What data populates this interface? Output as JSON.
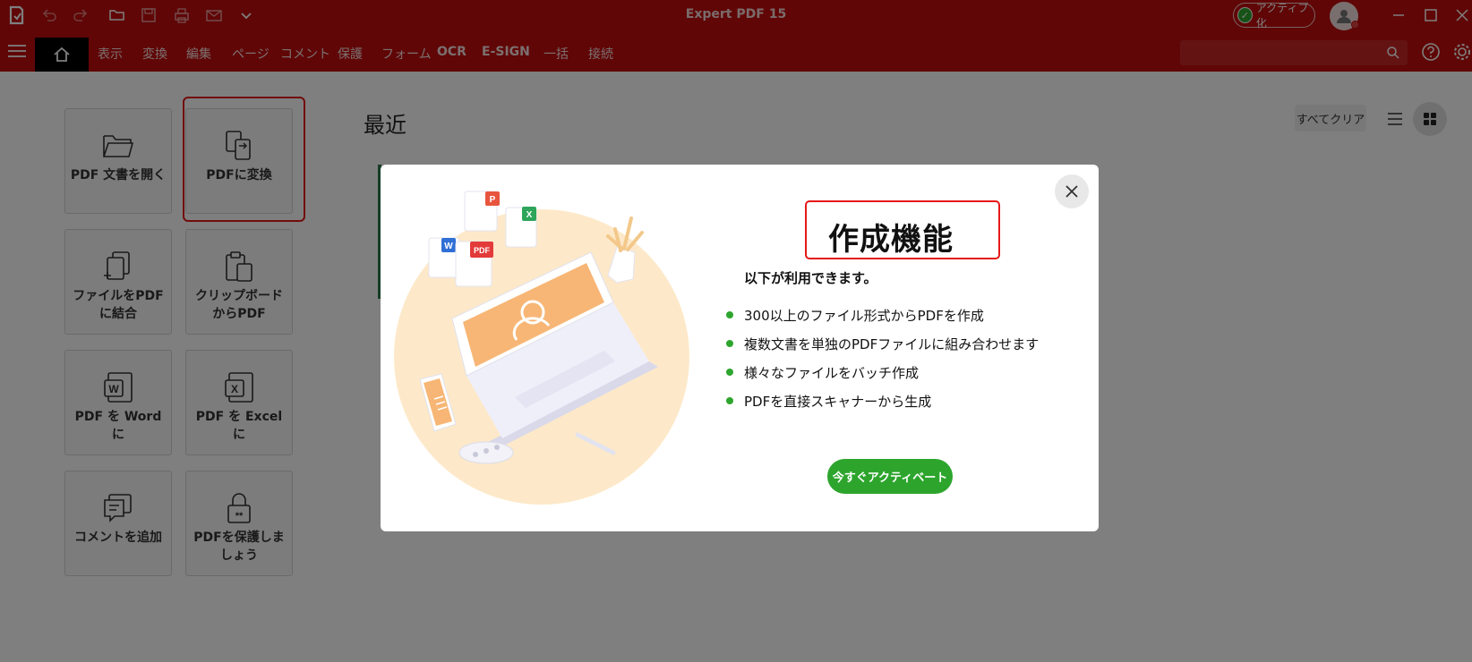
{
  "window": {
    "title": "Expert PDF 15",
    "activate_label": "アクティブ化",
    "brand_red": "#c10c0c"
  },
  "quick_access": [
    "undo-icon",
    "redo-icon",
    "open-folder-icon",
    "save-icon",
    "print-icon",
    "mail-icon",
    "chevron-down-icon"
  ],
  "menu": {
    "items": [
      {
        "label": "表示"
      },
      {
        "label": "変換"
      },
      {
        "label": "編集"
      },
      {
        "label": "ページ"
      },
      {
        "label": "コメント"
      },
      {
        "label": "保護"
      },
      {
        "label": "フォーム"
      },
      {
        "label": "OCR"
      },
      {
        "label": "E-SIGN"
      },
      {
        "label": "一括"
      },
      {
        "label": "接続"
      }
    ]
  },
  "tiles": [
    {
      "label": "PDF 文書を開く",
      "icon": "open-folder-icon"
    },
    {
      "label": "PDFに変換",
      "icon": "convert-icon"
    },
    {
      "label": "ファイルをPDFに結合",
      "icon": "combine-files-icon"
    },
    {
      "label": "クリップボードからPDF",
      "icon": "clipboard-icon"
    },
    {
      "label": "PDF を Word に",
      "icon": "word-icon"
    },
    {
      "label": "PDF を Excel に",
      "icon": "excel-icon"
    },
    {
      "label": "コメントを追加",
      "icon": "comment-icon"
    },
    {
      "label": "PDFを保護しましょう",
      "icon": "lock-icon"
    }
  ],
  "recent": {
    "title": "最近",
    "clear_all": "すべてクリア"
  },
  "modal": {
    "title": "作成機能",
    "subtitle": "以下が利用できます。",
    "features": [
      "300以上のファイル形式からPDFを作成",
      "複数文書を単独のPDFファイルに組み合わせます",
      "様々なファイルをバッチ作成",
      "PDFを直接スキャナーから生成"
    ],
    "activate_button": "今すぐアクティベート",
    "accent_color": "#2da52d"
  }
}
